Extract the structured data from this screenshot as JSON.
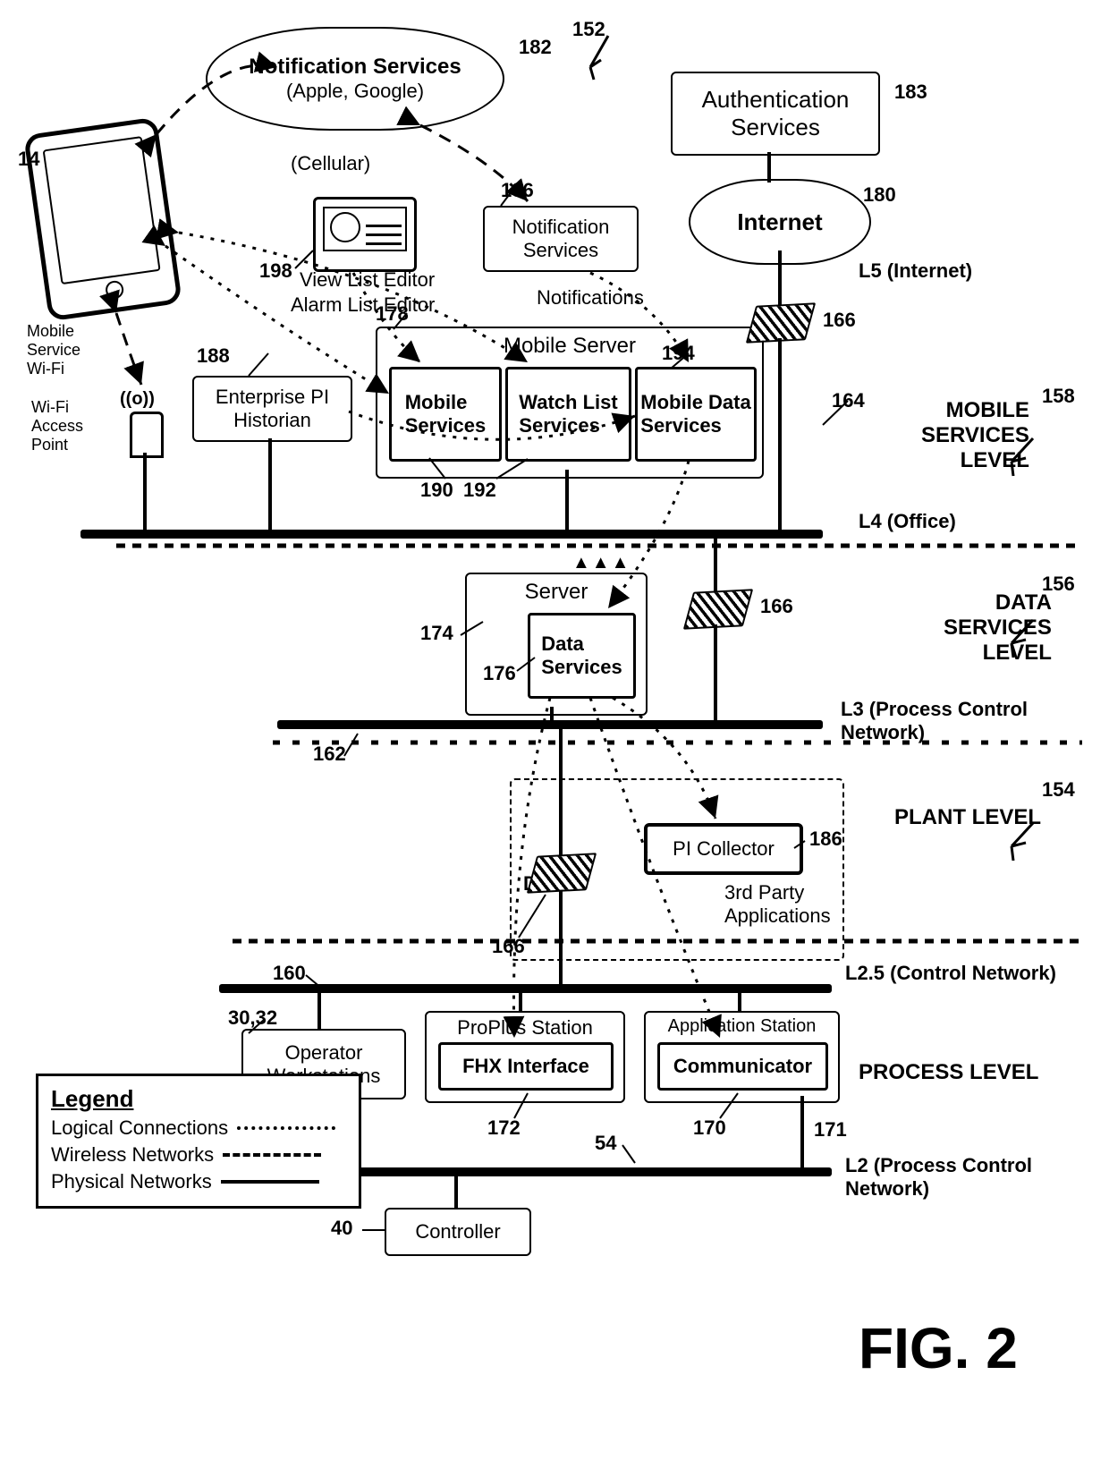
{
  "figure": "FIG. 2",
  "refs": {
    "system": "152",
    "mobile_device": "14",
    "notif_ext": "182",
    "auth": "183",
    "internet": "180",
    "fw": "166",
    "l4": "164",
    "l3": "162",
    "l25": "160",
    "l2": "54",
    "notif_int": "196",
    "editor": "198",
    "historian": "188",
    "mobile_server": "178",
    "m_services": "190",
    "wl_services": "192",
    "md_services": "194",
    "server": "174",
    "data_services": "176",
    "dmz": "DMZ",
    "pi_collector": "186",
    "proplus": "ProPlus Station",
    "fhx": "FHX Interface",
    "appstation": "Application Station",
    "communicator": "Communicator",
    "opws": "30,32",
    "controller": "40",
    "fhx_ref": "172",
    "comm_ref": "170",
    "comm_conn": "171"
  },
  "labels": {
    "cellular": "(Cellular)",
    "wifi": "Mobile\nService\nWi-Fi",
    "ap": "Wi-Fi\nAccess\nPoint",
    "l5": "L5 (Internet)",
    "l4": "L4 (Office)",
    "l3": "L3 (Process Control\nNetwork)",
    "l25": "L2.5 (Control Network)",
    "l2": "L2 (Process Control\nNetwork)",
    "mobile_level": "MOBILE\nSERVICES\nLEVEL",
    "data_level": "DATA\nSERVICES\nLEVEL",
    "plant_level": "PLANT LEVEL",
    "process_level": "PROCESS LEVEL",
    "l_mobile": "158",
    "l_data": "156",
    "l_plant": "154",
    "notifications": "Notifications",
    "third_party": "3rd Party\nApplications"
  },
  "text": {
    "notif_ext_line1": "Notification Services",
    "notif_ext_line2": "(Apple, Google)",
    "auth": "Authentication\nServices",
    "internet": "Internet",
    "notif_int": "Notification\nServices",
    "editor1": "View List Editor",
    "editor2": "Alarm List Editor",
    "historian": "Enterprise PI\nHistorian",
    "mobile_server": "Mobile Server",
    "m_services": "Mobile\nServices",
    "wl_services": "Watch List\nServices",
    "md_services": "Mobile Data\nServices",
    "server": "Server",
    "data_services": "Data\nServices",
    "pi_collector": "PI Collector",
    "proplus": "ProPlus Station",
    "fhx": "FHX Interface",
    "appstation": "Application Station",
    "communicator": "Communicator",
    "opws": "Operator\nWorkstations",
    "controller": "Controller",
    "dmz": "DMZ"
  },
  "legend": {
    "title": "Legend",
    "logical": "Logical Connections",
    "wireless": "Wireless Networks",
    "physical": "Physical Networks"
  }
}
